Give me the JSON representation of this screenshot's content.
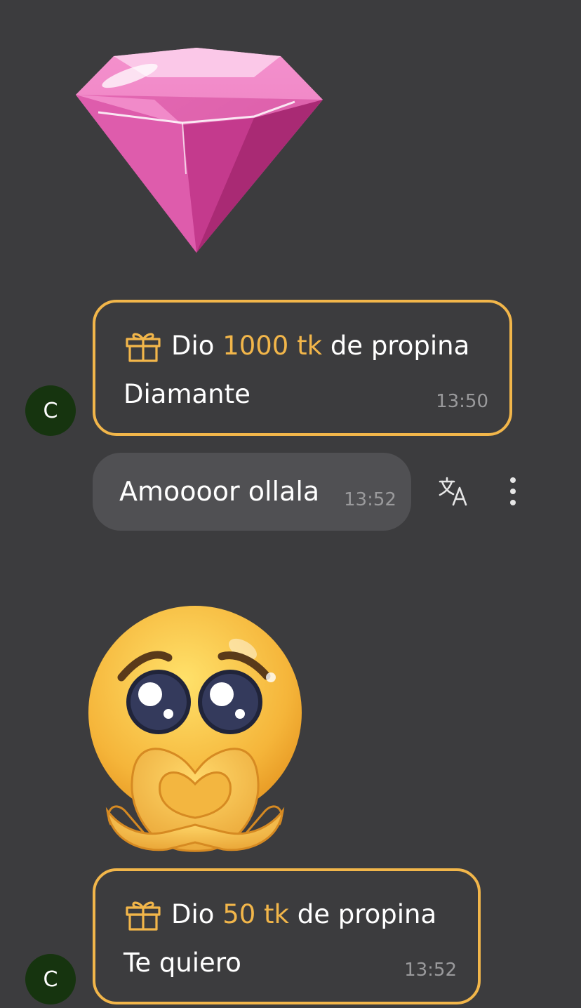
{
  "messages": [
    {
      "type": "sticker",
      "sticker": "pink-diamond-icon"
    },
    {
      "type": "tip",
      "icon": "gift-icon",
      "prefix": "Dio",
      "amount": "1000 tk",
      "suffix": "de propina",
      "note": "Diamante",
      "time": "13:50",
      "avatar": "C"
    },
    {
      "type": "text",
      "text": "Amoooor ollala",
      "time": "13:52",
      "actions": [
        "translate-icon",
        "more-vertical-icon"
      ]
    },
    {
      "type": "sticker",
      "sticker": "pleading-face-icon"
    },
    {
      "type": "tip",
      "icon": "gift-icon",
      "prefix": "Dio",
      "amount": "50 tk",
      "suffix": "de propina",
      "note": "Te quiero",
      "time": "13:52",
      "avatar": "C"
    }
  ],
  "colors": {
    "background": "#3c3c3e",
    "accent": "#f2b64a",
    "bubble": "#505053",
    "timestamp": "#9a9a9c",
    "avatar": "#16340f"
  }
}
